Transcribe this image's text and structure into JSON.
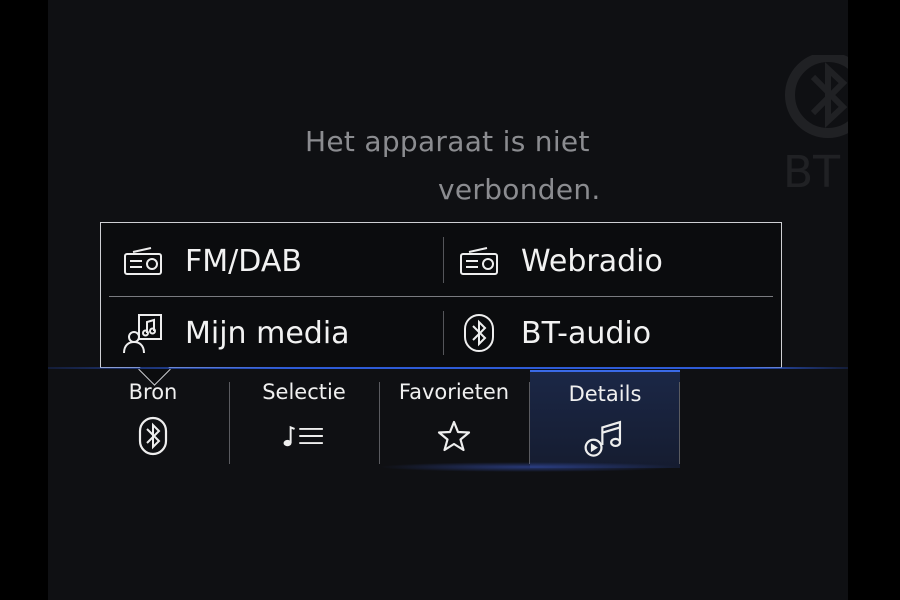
{
  "status": {
    "line1": "Het apparaat is niet",
    "line2": "verbonden."
  },
  "source_menu": {
    "options": [
      {
        "label": "FM/DAB",
        "icon": "radio-icon"
      },
      {
        "label": "Webradio",
        "icon": "radio-icon"
      },
      {
        "label": "Mijn media",
        "icon": "user-media-icon"
      },
      {
        "label": "BT-audio",
        "icon": "bluetooth-icon"
      }
    ]
  },
  "tabs": [
    {
      "label": "Bron",
      "icon": "bluetooth-icon",
      "active": false
    },
    {
      "label": "Selectie",
      "icon": "playlist-icon",
      "active": false
    },
    {
      "label": "Favorieten",
      "icon": "star-icon",
      "active": false
    },
    {
      "label": "Details",
      "icon": "music-play-icon",
      "active": true
    }
  ],
  "colors": {
    "background": "#0f1013",
    "accent": "#2e5bd6",
    "status_text": "#8b8c90"
  }
}
